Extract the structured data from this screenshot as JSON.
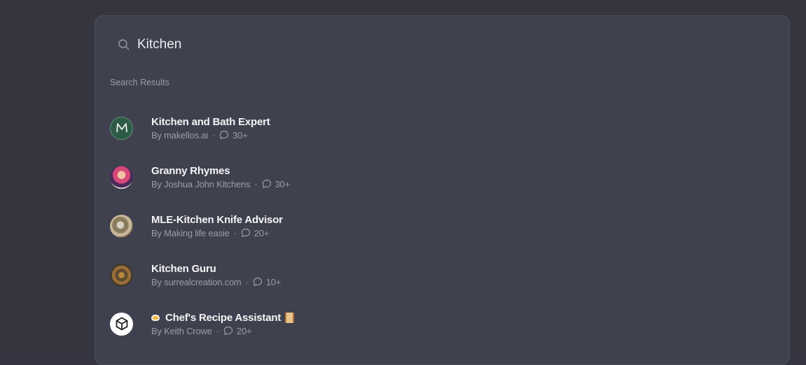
{
  "search": {
    "value": "Kitchen"
  },
  "section_label": "Search Results",
  "results": [
    {
      "title": "Kitchen and Bath Expert",
      "author": "By makellos.ai",
      "separator": "·",
      "count": "30+",
      "avatar_letter": "M"
    },
    {
      "title": "Granny Rhymes",
      "author": "By Joshua John Kitchens",
      "separator": "·",
      "count": "30+"
    },
    {
      "title": "MLE-Kitchen Knife Advisor",
      "author": "By Making life easie",
      "separator": "·",
      "count": "20+"
    },
    {
      "title": "Kitchen Guru",
      "author": "By surrealcreation.com",
      "separator": "·",
      "count": "10+"
    },
    {
      "title": "Chef's Recipe Assistant",
      "author": "By Keith Crowe",
      "separator": "·",
      "count": "20+"
    }
  ],
  "colors": {
    "background": "#35353f",
    "panel": "#40414f",
    "text_primary": "#f4f4f6",
    "text_secondary": "#9b9ca8"
  },
  "icons": {
    "search": "search-icon",
    "chat": "chat-bubble-icon",
    "chef_avatar": "cube-icon"
  }
}
